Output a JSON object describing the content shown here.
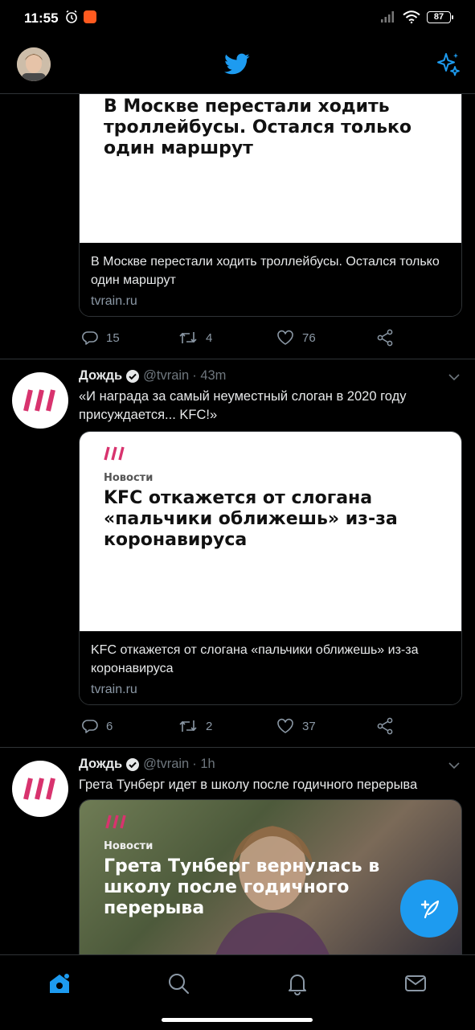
{
  "status": {
    "time": "11:55",
    "battery": "87"
  },
  "tweets": [
    {
      "card": {
        "headline": "В Москве перестали ходить троллейбусы. Остался только один маршрут",
        "title": "В Москве перестали ходить троллейбусы. Остался только один маршрут",
        "domain": "tvrain.ru"
      },
      "replies": "15",
      "retweets": "4",
      "likes": "76"
    },
    {
      "name": "Дождь",
      "handle": "@tvrain",
      "time": "· 43m",
      "text": "«И награда за самый неуместный слоган в 2020 году присуждается... KFC!»",
      "card": {
        "kicker": "Новости",
        "headline": "KFC откажется от слогана «пальчики оближешь» из-за коронавируса",
        "title": "KFC откажется от слогана «пальчики оближешь» из-за коронавируса",
        "domain": "tvrain.ru"
      },
      "replies": "6",
      "retweets": "2",
      "likes": "37"
    },
    {
      "name": "Дождь",
      "handle": "@tvrain",
      "time": "· 1h",
      "text": "Грета Тунберг идет в школу после годичного перерыва",
      "card": {
        "kicker": "Новости",
        "headline": "Грета Тунберг вернулась в школу после годичного перерыва"
      }
    }
  ],
  "nav": [
    "home-icon",
    "search-icon",
    "bell-icon",
    "mail-icon"
  ],
  "colors": {
    "accent": "#1d9bf0",
    "brand_pink": "#d8336e",
    "background": "#000000"
  }
}
